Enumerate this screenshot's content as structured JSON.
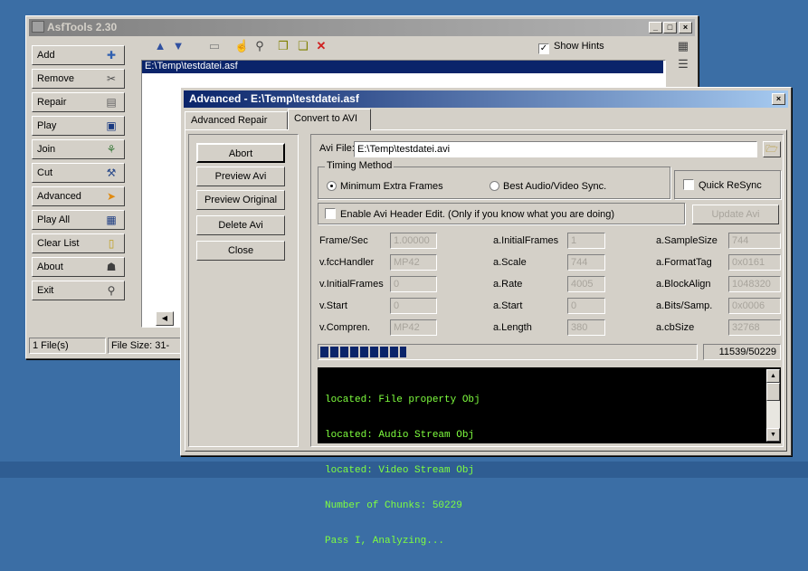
{
  "main_window": {
    "title": "AsfTools 2.30",
    "buttons": [
      {
        "label": "Add",
        "icon": "add-icon"
      },
      {
        "label": "Remove",
        "icon": "remove-icon"
      },
      {
        "label": "Repair",
        "icon": "repair-icon"
      },
      {
        "label": "Play",
        "icon": "play-icon"
      },
      {
        "label": "Join",
        "icon": "join-icon"
      },
      {
        "label": "Cut",
        "icon": "cut-icon"
      },
      {
        "label": "Advanced",
        "icon": "advanced-icon"
      },
      {
        "label": "Play All",
        "icon": "play-all-icon"
      },
      {
        "label": "Clear List",
        "icon": "clear-list-icon"
      },
      {
        "label": "About",
        "icon": "about-icon"
      },
      {
        "label": "Exit",
        "icon": "exit-icon"
      }
    ],
    "show_hints_label": "Show Hints",
    "file_list": [
      "E:\\Temp\\testdatei.asf"
    ],
    "status": {
      "files": "1 File(s)",
      "size": "File Size: 31-"
    }
  },
  "dialog": {
    "title": "Advanced - E:\\Temp\\testdatei.asf",
    "tabs": [
      "Advanced Repair",
      "Convert to AVI"
    ],
    "active_tab": "Convert to AVI",
    "actions": [
      "Abort",
      "Preview Avi",
      "Preview Original",
      "Delete Avi",
      "Close"
    ],
    "avi_file_label": "Avi File:",
    "avi_file_value": "E:\\Temp\\testdatei.avi",
    "timing_method": {
      "legend": "Timing Method",
      "option1": "Minimum Extra Frames",
      "option2": "Best Audio/Video Sync."
    },
    "quick_resync_label": "Quick ReSync",
    "header_edit_label": "Enable Avi Header Edit. (Only if you know what you are doing)",
    "update_avi_label": "Update Avi",
    "fields": {
      "frame_sec": {
        "label": "Frame/Sec",
        "value": "1.00000"
      },
      "fcc_handler": {
        "label": "v.fccHandler",
        "value": "MP42"
      },
      "v_initial_frames": {
        "label": "v.InitialFrames",
        "value": "0"
      },
      "v_start": {
        "label": "v.Start",
        "value": "0"
      },
      "v_compren": {
        "label": "v.Compren.",
        "value": "MP42"
      },
      "a_initial_frames": {
        "label": "a.InitialFrames",
        "value": "1"
      },
      "a_scale": {
        "label": "a.Scale",
        "value": "744"
      },
      "a_rate": {
        "label": "a.Rate",
        "value": "4005"
      },
      "a_start": {
        "label": "a.Start",
        "value": "0"
      },
      "a_length": {
        "label": "a.Length",
        "value": "380"
      },
      "a_sample_size": {
        "label": "a.SampleSize",
        "value": "744"
      },
      "a_format_tag": {
        "label": "a.FormatTag",
        "value": "0x0161"
      },
      "a_block_align": {
        "label": "a.BlockAlign",
        "value": "1048320"
      },
      "a_bits_samp": {
        "label": "a.Bits/Samp.",
        "value": "0x0006"
      },
      "a_cb_size": {
        "label": "a.cbSize",
        "value": "32768"
      }
    },
    "progress": {
      "text": "11539/50229",
      "fraction": 0.23
    },
    "console_lines": [
      "located: File property Obj",
      "located: Audio Stream Obj",
      "located: Video Stream Obj",
      "Number of Chunks: 50229",
      "Pass I, Analyzing..."
    ]
  },
  "colors": {
    "desktop": "#3b6ea5",
    "selection": "#0a246a",
    "progress": "#0a246a",
    "console_text": "#7fff3f"
  }
}
